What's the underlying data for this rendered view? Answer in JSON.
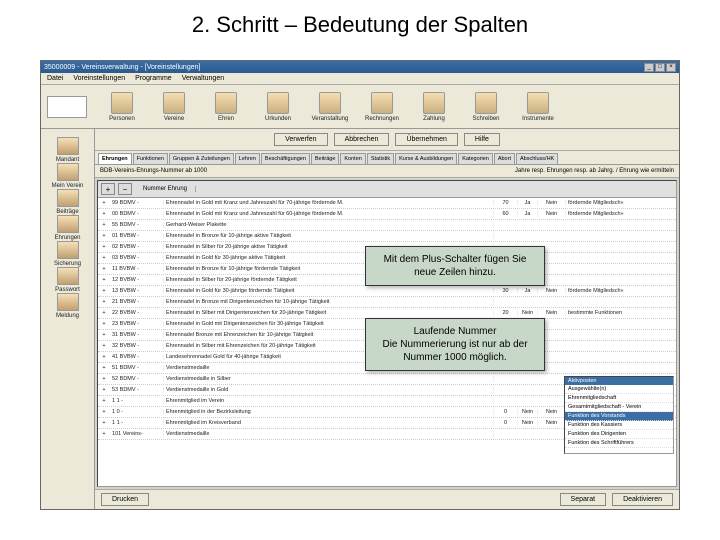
{
  "slide_title": "2. Schritt – Bedeutung der Spalten",
  "window": {
    "title": "35000009 - Vereinsverwaltung - [Voreinstellungen]",
    "menu": [
      "Datei",
      "Voreinstellungen",
      "Programme",
      "Verwaltungen"
    ],
    "toolbar": [
      {
        "label": "Personen"
      },
      {
        "label": "Vereine"
      },
      {
        "label": "Ehren"
      },
      {
        "label": "Urkunden"
      },
      {
        "label": "Veranstaltung"
      },
      {
        "label": "Rechnungen"
      },
      {
        "label": "Zahlung"
      },
      {
        "label": "Schreiben"
      },
      {
        "label": "Instrumente"
      }
    ]
  },
  "sidebar": [
    {
      "label": "Mandant"
    },
    {
      "label": "Mein Verein"
    },
    {
      "label": "Beiträge"
    },
    {
      "label": "Ehrungen"
    },
    {
      "label": "Sicherung"
    },
    {
      "label": "Passwort"
    },
    {
      "label": "Meldung"
    }
  ],
  "button_row": [
    "Verwerfen",
    "Abbrechen",
    "Übernehmen",
    "Hilfe"
  ],
  "tabs": [
    "Ehrungen",
    "Funktionen",
    "Gruppen & Zuteilungen",
    "Lehren",
    "Beschäftigungen",
    "Beiträge",
    "Konten",
    "Statistik",
    "Kurse & Ausbildungen",
    "Kategorien",
    "Abort",
    "Abschluss/HK"
  ],
  "active_tab": 0,
  "subheader_left": "BDB-Vereins-Ehrungs-Nummer ab 1000",
  "subheader_right": "Jahre resp. Ehrungen resp. ab Jahrg. / Ehrung wie ermitteln",
  "grid": {
    "plus_label": "+",
    "minus_label": "−",
    "col_name": "Nummer Ehrung",
    "rows": [
      {
        "num": "99 BDMV -",
        "desc": "Ehrennadel in Gold mit Kranz und Jahreszahl für 70-jährige fördernde M.",
        "c2": "70",
        "c3": "Ja",
        "c4": "Nein",
        "c5": "fördernde Mitgliedsch«"
      },
      {
        "num": "00 BDMV -",
        "desc": "Ehrennadel in Gold mit Kranz und Jahreszahl für 60-jährige fördernde M.",
        "c2": "60",
        "c3": "Ja",
        "c4": "Nein",
        "c5": "fördernde Mitgliedsch«"
      },
      {
        "num": "55 BDMV -",
        "desc": "Gerhard-Weiser Plakette",
        "c2": "",
        "c3": "",
        "c4": "",
        "c5": ""
      },
      {
        "num": "01 BVBW -",
        "desc": "Ehrennadel in Bronze für 10-jährige aktive Tätigkeit",
        "c2": "",
        "c3": "",
        "c4": "",
        "c5": ""
      },
      {
        "num": "02 BVBW -",
        "desc": "Ehrennadel in Silber für 20-jährige aktive Tätigkeit",
        "c2": "",
        "c3": "",
        "c4": "",
        "c5": ""
      },
      {
        "num": "03 BVBW -",
        "desc": "Ehrennadel in Gold für 30-jährige aktive Tätigkeit",
        "c2": "",
        "c3": "",
        "c4": "",
        "c5": ""
      },
      {
        "num": "11 BVBW -",
        "desc": "Ehrennadel in Bronze für 10-jährige fördernde Tätigkeit",
        "c2": "",
        "c3": "",
        "c4": "",
        "c5": ""
      },
      {
        "num": "12 BVBW -",
        "desc": "Ehrennadel in Silber für 20-jährige fördernde Tätigkeit",
        "c2": "",
        "c3": "",
        "c4": "",
        "c5": ""
      },
      {
        "num": "13 BVBW -",
        "desc": "Ehrennadel in Gold für 30-jährige fördernde Tätigkeit",
        "c2": "30",
        "c3": "Ja",
        "c4": "Nein",
        "c5": "fördernde Mitgliedsch«"
      },
      {
        "num": "21 BVBW -",
        "desc": "Ehrennadel in Bronze mit Dirigentenzeichen für 10-jährige Tätigkeit",
        "c2": "",
        "c3": "",
        "c4": "",
        "c5": ""
      },
      {
        "num": "22 BVBW -",
        "desc": "Ehrennadel in Silber mit Dirigentenzeichen für 20-jährige Tätigkeit",
        "c2": "20",
        "c3": "Nein",
        "c4": "Nein",
        "c5": "bestimmte Funktionen"
      },
      {
        "num": "23 BVBW -",
        "desc": "Ehrennadel in Gold mit Dirigentenzeichen für 30-jährige Tätigkeit",
        "c2": "",
        "c3": "",
        "c4": "",
        "c5": ""
      },
      {
        "num": "31 BVBW -",
        "desc": "Ehrennadel Bronze mit Ehrenzeichen für 10-jährige Tätigkeit",
        "c2": "",
        "c3": "",
        "c4": "",
        "c5": ""
      },
      {
        "num": "32 BVBW -",
        "desc": "Ehrennadel in Silber mit Ehrenzeichen für 20-jährige Tätigkeit",
        "c2": "",
        "c3": "",
        "c4": "",
        "c5": ""
      },
      {
        "num": "41 BVBW -",
        "desc": "Landesehrennadel Gold für 40-jährige Tätigkeit",
        "c2": "",
        "c3": "",
        "c4": "",
        "c5": ""
      },
      {
        "num": "51 BDMV -",
        "desc": "Verdienstmedaille",
        "c2": "",
        "c3": "",
        "c4": "",
        "c5": ""
      },
      {
        "num": "52 BDMV -",
        "desc": "Verdienstmedaille in Silber",
        "c2": "",
        "c3": "",
        "c4": "",
        "c5": ""
      },
      {
        "num": "53 BDMV -",
        "desc": "Verdienstmedaille in Gold",
        "c2": "",
        "c3": "",
        "c4": "",
        "c5": ""
      },
      {
        "num": "1 1 -",
        "desc": "Ehrenmitglied im Verein",
        "c2": "",
        "c3": "",
        "c4": "",
        "c5": ""
      },
      {
        "num": "1 0 -",
        "desc": "Ehrenmitglied in der Bezirksleitung",
        "c2": "0",
        "c3": "Nein",
        "c4": "Nein",
        "c5": ""
      },
      {
        "num": "1 1 -",
        "desc": "Ehrenmitglied im Kreisverband",
        "c2": "0",
        "c3": "Nein",
        "c4": "Nein",
        "c5": ""
      },
      {
        "num": "101 Vereins-",
        "desc": "Verdienstmedaille",
        "c2": "",
        "c3": "",
        "c4": "",
        "c5": ""
      }
    ]
  },
  "right_panel": {
    "header": "Aktivposten",
    "items": [
      "Ausgewählte(n)",
      "Ehrenmitgliedschaft",
      "Gesamtmitgliedschaft - Verein",
      "Funktion des Vorstands",
      "Funktion des Kassiers",
      "Funktion des Dirigenten",
      "Funktion des Schriftführers"
    ],
    "selected": 3
  },
  "footer": {
    "left": "Drucken",
    "mid": "Separat",
    "right": "Deaktivieren"
  },
  "callouts": {
    "c1": "Mit dem Plus-Schalter fügen Sie neue Zeilen hinzu.",
    "c2_l1": "Laufende Nummer",
    "c2_l2": "Die Nummerierung ist nur ab der Nummer 1000 möglich."
  }
}
